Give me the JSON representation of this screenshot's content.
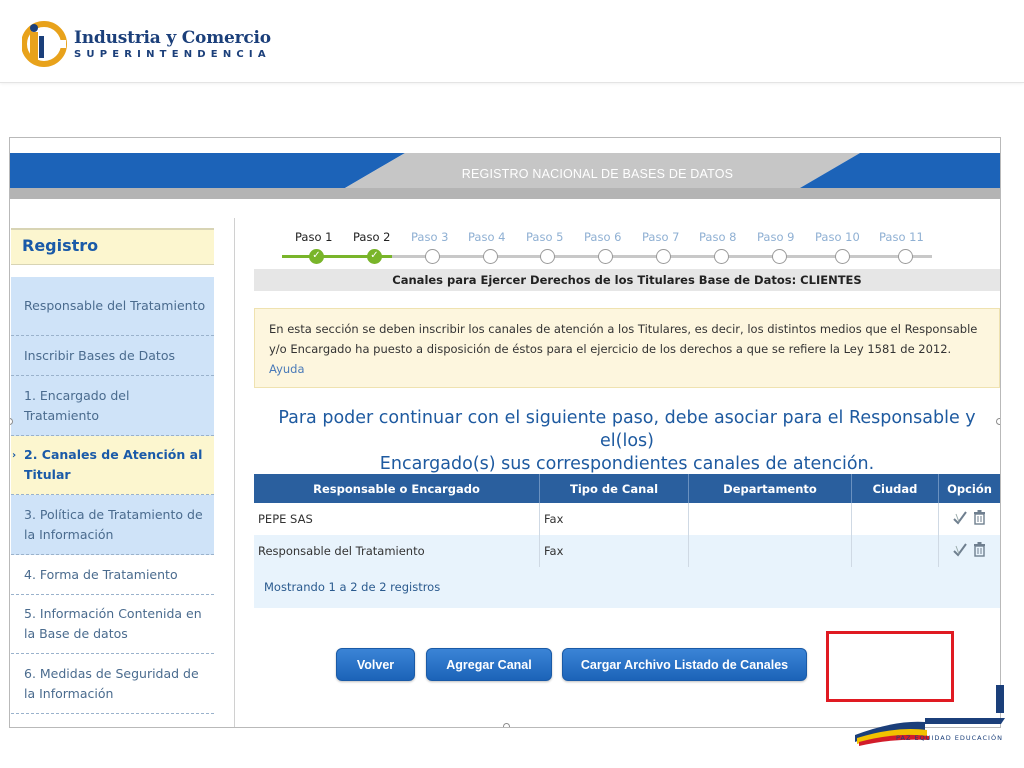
{
  "brand": {
    "line1": "Industria y Comercio",
    "line2": "SUPERINTENDENCIA"
  },
  "banner": {
    "title": "REGISTRO NACIONAL DE BASES DE DATOS"
  },
  "sidebar": {
    "title": "Registro",
    "items": [
      {
        "label": "Responsable del Tratamiento"
      },
      {
        "label": "Inscribir Bases de Datos"
      },
      {
        "label": "1. Encargado del Tratamiento"
      },
      {
        "label": "2. Canales de Atención al Titular"
      },
      {
        "label": "3. Política de Tratamiento de la Información"
      },
      {
        "label": "4. Forma de Tratamiento"
      },
      {
        "label": "5. Información Contenida en la Base de datos"
      },
      {
        "label": "6. Medidas de Seguridad de la Información"
      }
    ]
  },
  "stepper": {
    "steps": [
      {
        "label": "Paso 1",
        "status": "done"
      },
      {
        "label": "Paso 2",
        "status": "done"
      },
      {
        "label": "Paso 3",
        "status": "pending"
      },
      {
        "label": "Paso 4",
        "status": "pending"
      },
      {
        "label": "Paso 5",
        "status": "pending"
      },
      {
        "label": "Paso 6",
        "status": "pending"
      },
      {
        "label": "Paso 7",
        "status": "pending"
      },
      {
        "label": "Paso 8",
        "status": "pending"
      },
      {
        "label": "Paso 9",
        "status": "pending"
      },
      {
        "label": "Paso 10",
        "status": "pending"
      },
      {
        "label": "Paso 11",
        "status": "pending"
      }
    ]
  },
  "section": {
    "title": "Canales para Ejercer Derechos de los Titulares Base de Datos: CLIENTES"
  },
  "info": {
    "line1": "En esta sección se deben inscribir los canales de atención a los Titulares, es decir, los distintos medios que el Responsable",
    "line2": "y/o Encargado ha puesto a disposición de éstos para el ejercicio de los derechos a que se refiere la Ley 1581 de 2012.",
    "help_label": "Ayuda"
  },
  "lead": {
    "line1": "Para poder continuar con el siguiente paso, debe asociar para el Responsable y el(los)",
    "line2": "Encargado(s) sus correspondientes canales de atención."
  },
  "table": {
    "headers": [
      "Responsable o Encargado",
      "Tipo de Canal",
      "Departamento",
      "Ciudad",
      "Opción"
    ],
    "rows": [
      {
        "responsable": "PEPE SAS",
        "tipo": "Fax",
        "departamento": "",
        "ciudad": ""
      },
      {
        "responsable": "Responsable del Tratamiento",
        "tipo": "Fax",
        "departamento": "",
        "ciudad": ""
      }
    ],
    "footer": "Mostrando 1 a 2 de 2 registros"
  },
  "buttons": {
    "back": "Volver",
    "add_channel": "Agregar Canal",
    "upload": "Cargar Archivo Listado de Canales"
  },
  "footer_logo": {
    "motto": "PAZ  EQUIDAD  EDUCACIÓN"
  },
  "colors": {
    "brand_blue": "#1c63b8",
    "table_header": "#2a5f9e",
    "done_green": "#79b52a",
    "highlight_red": "#e01a22"
  }
}
